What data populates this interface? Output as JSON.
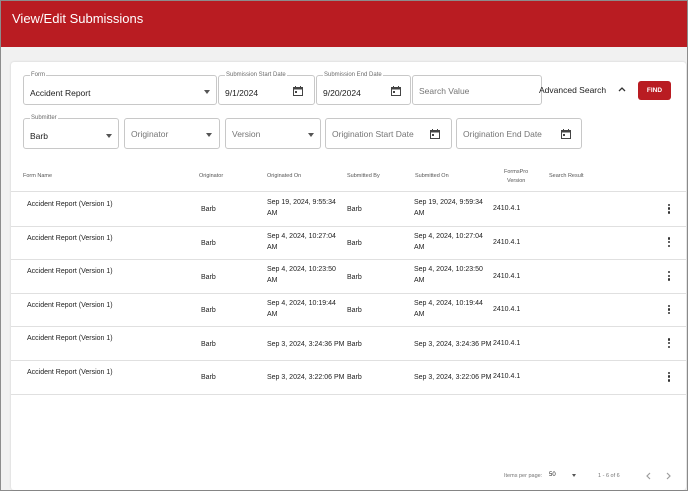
{
  "header": {
    "title": "View/Edit Submissions"
  },
  "filters": {
    "form": {
      "label": "Form",
      "value": "Accident Report"
    },
    "start_date": {
      "label": "Submission Start Date",
      "value": "9/1/2024"
    },
    "end_date": {
      "label": "Submission End Date",
      "value": "9/20/2024"
    },
    "search_value": {
      "placeholder": "Search Value"
    },
    "advanced_search": "Advanced Search",
    "find": "FIND",
    "submitter": {
      "label": "Submitter",
      "value": "Barb"
    },
    "originator": {
      "placeholder": "Originator"
    },
    "version": {
      "placeholder": "Version"
    },
    "origination_start": {
      "placeholder": "Origination Start Date"
    },
    "origination_end": {
      "placeholder": "Origination End Date"
    }
  },
  "table": {
    "columns": {
      "form_name": "Form Name",
      "originator": "Originator",
      "originated_on": "Originated On",
      "submitted_by": "Submitted By",
      "submitted_on": "Submitted On",
      "formspro_version_1": "FormsPro",
      "formspro_version_2": "Version",
      "search_result": "Search Result"
    },
    "rows": [
      {
        "form_name": "Accident Report (Version 1)",
        "originator": "Barb",
        "originated_on": [
          "Sep 19, 2024, 9:55:34",
          "AM"
        ],
        "submitted_by": "Barb",
        "submitted_on": [
          "Sep 19, 2024, 9:59:34",
          "AM"
        ],
        "version": "2410.4.1"
      },
      {
        "form_name": "Accident Report (Version 1)",
        "originator": "Barb",
        "originated_on": [
          "Sep 4, 2024, 10:27:04",
          "AM"
        ],
        "submitted_by": "Barb",
        "submitted_on": [
          "Sep 4, 2024, 10:27:04",
          "AM"
        ],
        "version": "2410.4.1"
      },
      {
        "form_name": "Accident Report (Version 1)",
        "originator": "Barb",
        "originated_on": [
          "Sep 4, 2024, 10:23:50",
          "AM"
        ],
        "submitted_by": "Barb",
        "submitted_on": [
          "Sep 4, 2024, 10:23:50",
          "AM"
        ],
        "version": "2410.4.1"
      },
      {
        "form_name": "Accident Report (Version 1)",
        "originator": "Barb",
        "originated_on": [
          "Sep 4, 2024, 10:19:44",
          "AM"
        ],
        "submitted_by": "Barb",
        "submitted_on": [
          "Sep 4, 2024, 10:19:44",
          "AM"
        ],
        "version": "2410.4.1"
      },
      {
        "form_name": "Accident Report (Version 1)",
        "originator": "Barb",
        "originated_on": [
          "Sep 3, 2024, 3:24:36 PM"
        ],
        "submitted_by": "Barb",
        "submitted_on": [
          "Sep 3, 2024, 3:24:36 PM"
        ],
        "version": "2410.4.1"
      },
      {
        "form_name": "Accident Report (Version 1)",
        "originator": "Barb",
        "originated_on": [
          "Sep 3, 2024, 3:22:06 PM"
        ],
        "submitted_by": "Barb",
        "submitted_on": [
          "Sep 3, 2024, 3:22:06 PM"
        ],
        "version": "2410.4.1"
      }
    ]
  },
  "pagination": {
    "items_per_page_label": "Items per page:",
    "items_per_page": "50",
    "range": "1 - 6 of 6"
  },
  "colors": {
    "brand": "#b91c22"
  }
}
